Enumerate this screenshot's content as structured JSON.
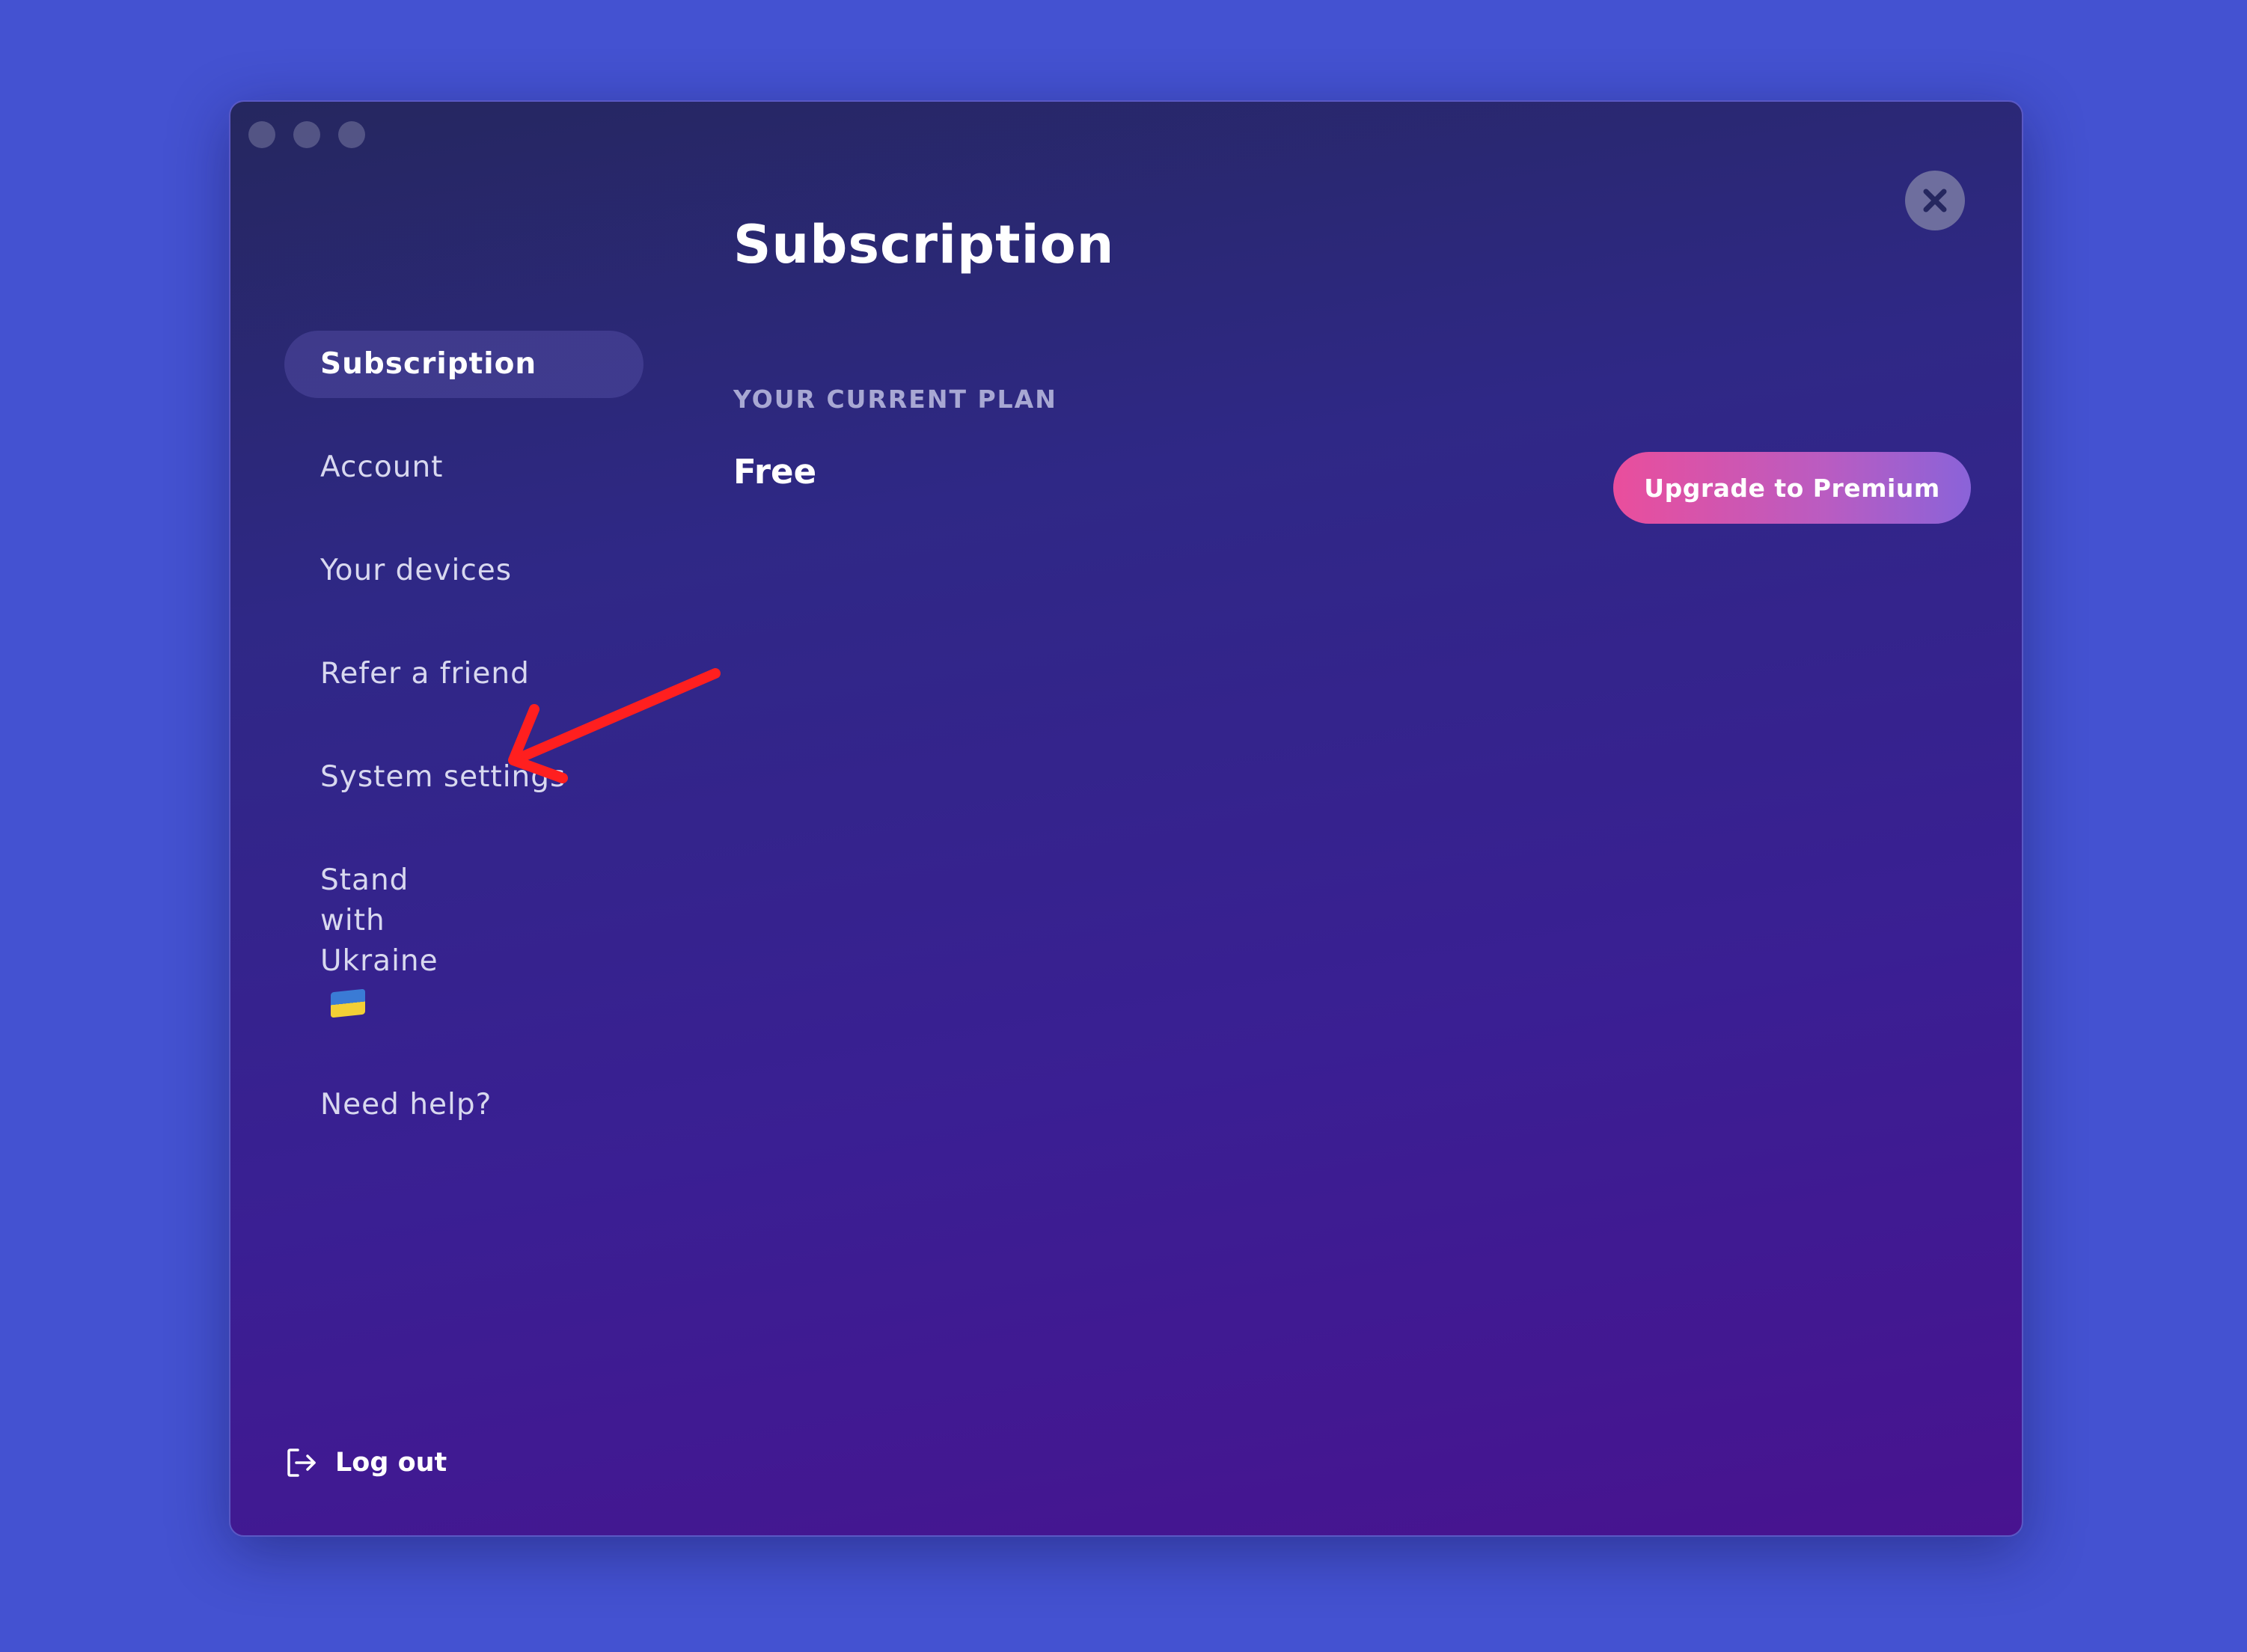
{
  "window": {
    "close_icon": "close-icon",
    "traffic_lights": [
      "close",
      "minimize",
      "maximize"
    ]
  },
  "sidebar": {
    "items": [
      {
        "id": "subscription",
        "label": "Subscription",
        "active": true
      },
      {
        "id": "account",
        "label": "Account",
        "active": false
      },
      {
        "id": "devices",
        "label": "Your devices",
        "active": false
      },
      {
        "id": "refer",
        "label": "Refer a friend",
        "active": false
      },
      {
        "id": "system",
        "label": "System settings",
        "active": false
      },
      {
        "id": "ukraine",
        "label": "Stand with Ukraine",
        "active": false,
        "icon": "ukraine-flag-icon"
      },
      {
        "id": "help",
        "label": "Need help?",
        "active": false
      }
    ],
    "logout_label": "Log out",
    "logout_icon": "logout-icon"
  },
  "main": {
    "title": "Subscription",
    "current_plan_label": "YOUR CURRENT PLAN",
    "current_plan_value": "Free",
    "upgrade_label": "Upgrade to Premium"
  },
  "colors": {
    "page_background": "#4452d1",
    "accent_pink": "#ea4e9c",
    "annotation_red": "#ff1f1f"
  }
}
